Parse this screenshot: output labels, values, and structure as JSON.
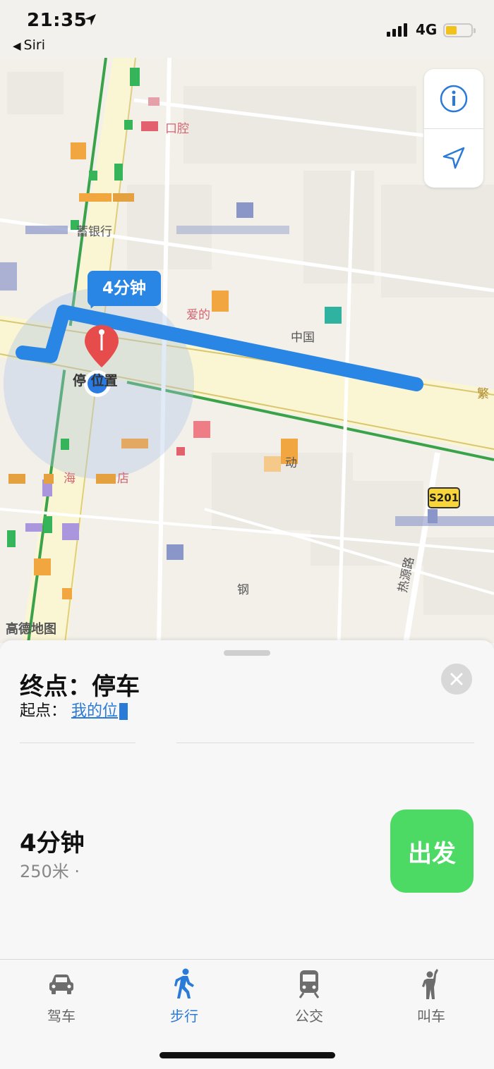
{
  "status_bar": {
    "time": "21:35",
    "back_app": "Siri",
    "network": "4G",
    "battery_color": "#f1c21b"
  },
  "map": {
    "eta_bubble": "4分钟",
    "destination_pin_label": "停 位置",
    "scale_sign": "S201",
    "provider": "高德地图",
    "labels": {
      "clinic": "口腔",
      "bank": "蓄银行",
      "love": "爱的",
      "china": "中国",
      "hotel": "店",
      "hai": "海",
      "reyuan_road": "热源路",
      "fan": "繁",
      "dong": "动",
      "gang": "钢"
    },
    "route_color": "#2a86e4",
    "walk_line_color": "#3aa34a",
    "controls": {
      "info_icon": "info-icon",
      "locate_icon": "location-arrow-icon"
    }
  },
  "sheet": {
    "destination_prefix": "终点：",
    "destination_name": "停车",
    "origin_prefix": "起点：",
    "origin_name": "我的位",
    "route_time": "4分钟",
    "route_distance": "250米 ·",
    "go_label": "出发"
  },
  "tabs": [
    {
      "label": "驾车",
      "icon": "car-icon",
      "active": false
    },
    {
      "label": "步行",
      "icon": "walk-icon",
      "active": true
    },
    {
      "label": "公交",
      "icon": "train-icon",
      "active": false
    },
    {
      "label": "叫车",
      "icon": "hail-icon",
      "active": false
    }
  ],
  "colors": {
    "accent_blue": "#2a7ad8",
    "go_green": "#4cd964"
  }
}
